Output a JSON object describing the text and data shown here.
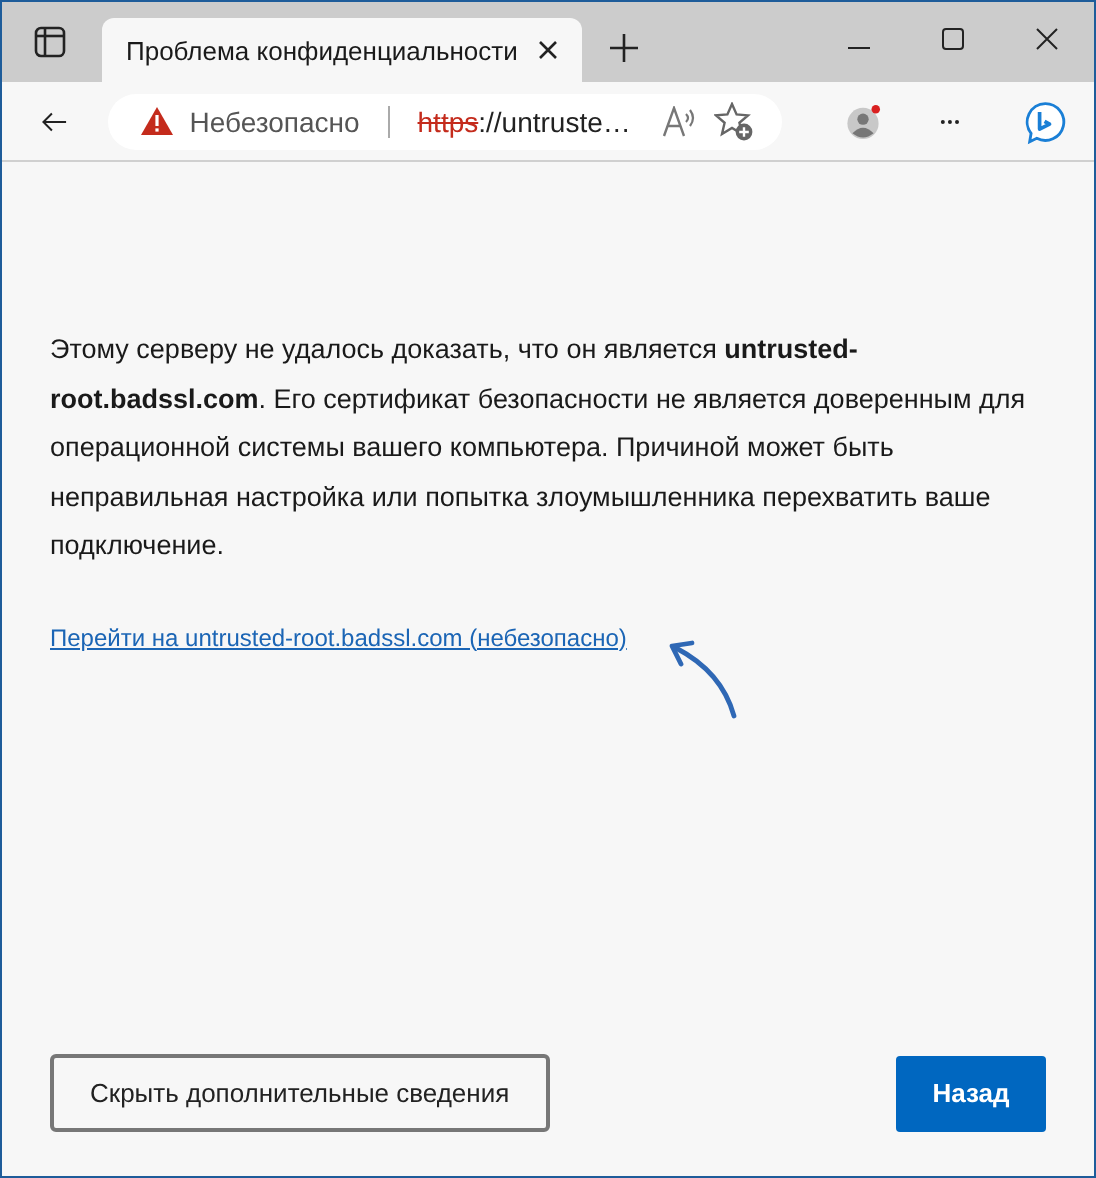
{
  "tab": {
    "title": "Проблема конфиденциальности",
    "selected": true
  },
  "address_bar": {
    "security_label": "Небезопасно",
    "url_scheme": "https",
    "url_rest": "://untruste…"
  },
  "profile": {
    "notification": true
  },
  "message": "Этому серверу не удалось доказать, что он является **untrusted-root.badssl.com**. Его сертификат безопасности не является доверенным для операционной системы вашего компьютера. Причиной может быть неправильная настройка или попытка злоумышленника перехватить ваше подключение.",
  "proceed_link": "Перейти на untrusted-root.badssl.com (небезопасно)",
  "buttons": [
    {
      "label": "Скрыть дополнительные сведения",
      "kind": "secondary"
    },
    {
      "label": "Назад",
      "kind": "primary"
    }
  ]
}
